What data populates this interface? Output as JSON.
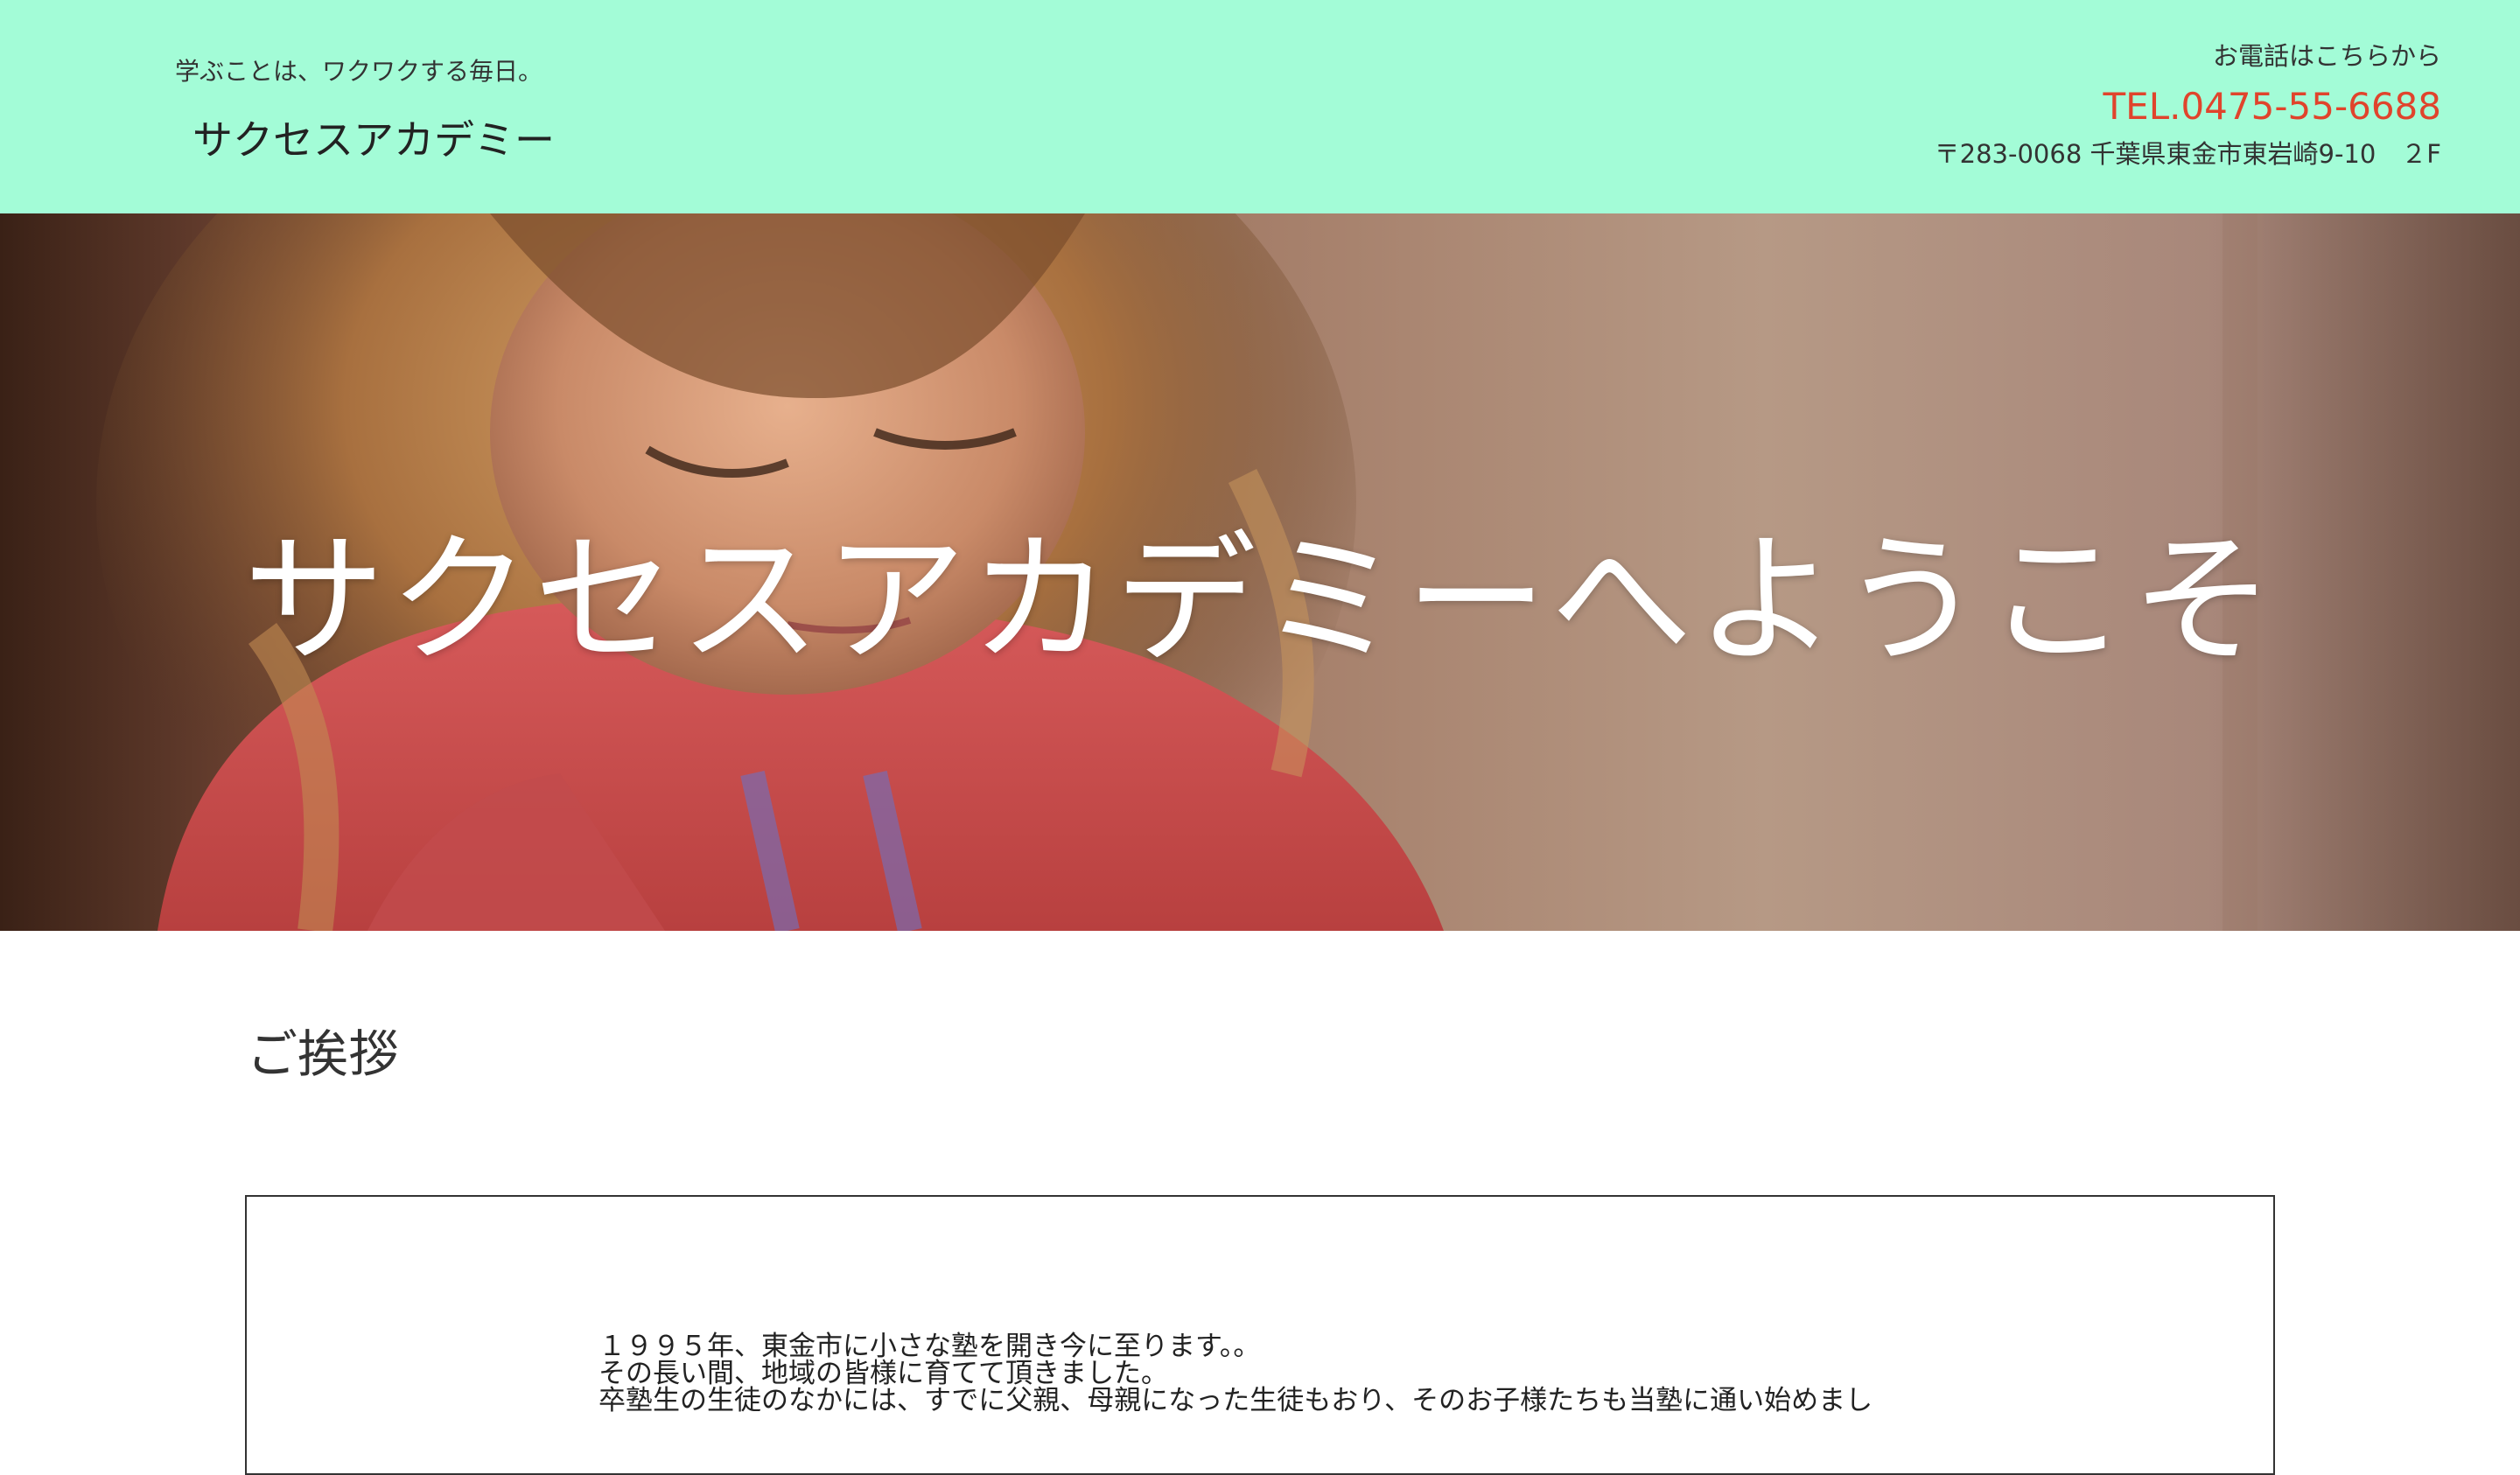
{
  "header": {
    "tagline": "学ぶことは、ワクワクする毎日。",
    "logo": "サクセスアカデミー",
    "contact": {
      "label": "お電話はこちらから",
      "tel": "TEL.0475-55-6688",
      "address": "〒283-0068 千葉県東金市東岩崎9-10　２F"
    },
    "background_color": "#a3fcd7",
    "tel_color": "#e0442c"
  },
  "hero": {
    "title": "サクセスアカデミーへようこそ",
    "image": "child-in-pink-shirt-photo"
  },
  "greeting": {
    "heading": "ご挨拶",
    "lines": [
      "１９９５年、東金市に小さな塾を開き今に至ります。。",
      "その長い間、地域の皆様に育てて頂きました。",
      "卒塾生の生徒のなかには、すでに父親、母親になった生徒もおり、そのお子様たちも当塾に通い始めまし"
    ]
  }
}
